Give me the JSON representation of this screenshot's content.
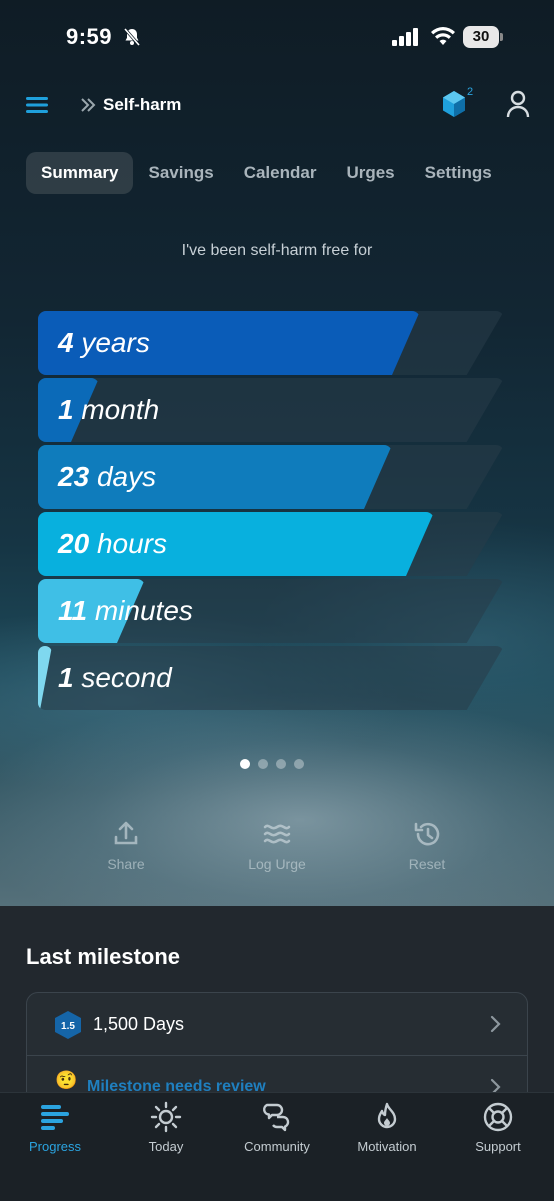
{
  "status": {
    "time": "9:59",
    "battery": "30"
  },
  "nav": {
    "title": "Self-harm",
    "gem_count": "2"
  },
  "tabs": [
    {
      "label": "Summary",
      "active": true
    },
    {
      "label": "Savings",
      "active": false
    },
    {
      "label": "Calendar",
      "active": false
    },
    {
      "label": "Urges",
      "active": false
    },
    {
      "label": "Settings",
      "active": false
    }
  ],
  "intro": "I've been self-harm free for",
  "counters": [
    {
      "value": "4",
      "unit": "years",
      "fill": 0.82,
      "color": "#0a5cb8"
    },
    {
      "value": "1",
      "unit": "month",
      "fill": 0.13,
      "color": "#0b6ab8"
    },
    {
      "value": "23",
      "unit": "days",
      "fill": 0.76,
      "color": "#0f7cbc"
    },
    {
      "value": "20",
      "unit": "hours",
      "fill": 0.85,
      "color": "#08b0de"
    },
    {
      "value": "11",
      "unit": "minutes",
      "fill": 0.23,
      "color": "#3fbfe6"
    },
    {
      "value": "1",
      "unit": "second",
      "fill": 0.02,
      "color": "#7fd8ef"
    }
  ],
  "pager": {
    "count": 4,
    "active": 0
  },
  "actions": {
    "share": "Share",
    "log_urge": "Log Urge",
    "reset": "Reset"
  },
  "milestone": {
    "heading": "Last milestone",
    "badge": "1.5",
    "label": "1,500 Days",
    "review_emoji": "🤨",
    "review_label": "Milestone needs review"
  },
  "bottom_nav": {
    "progress": "Progress",
    "today": "Today",
    "community": "Community",
    "motivation": "Motivation",
    "support": "Support"
  }
}
